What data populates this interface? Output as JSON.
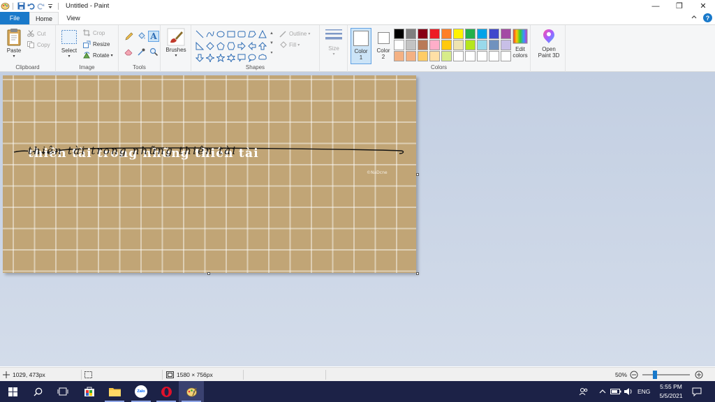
{
  "window": {
    "title": "Untitled - Paint",
    "controls": {
      "minimize": "—",
      "restore": "❐",
      "close": "✕"
    }
  },
  "tabs": [
    {
      "label": "File"
    },
    {
      "label": "Home"
    },
    {
      "label": "View"
    }
  ],
  "ribbon": {
    "clipboard": {
      "group_label": "Clipboard",
      "paste": "Paste",
      "cut": "Cut",
      "copy": "Copy"
    },
    "image": {
      "group_label": "Image",
      "select": "Select",
      "crop": "Crop",
      "resize": "Resize",
      "rotate": "Rotate"
    },
    "tools": {
      "group_label": "Tools",
      "brushes": "Brushes"
    },
    "shapes": {
      "group_label": "Shapes",
      "outline": "Outline",
      "fill": "Fill"
    },
    "size": {
      "label": "Size"
    },
    "colors": {
      "group_label": "Colors",
      "color1": "Color",
      "color1_num": "1",
      "color2": "Color",
      "color2_num": "2",
      "edit_colors_line1": "Edit",
      "edit_colors_line2": "colors",
      "palette_row1": [
        "#000000",
        "#7f7f7f",
        "#880015",
        "#ed1c24",
        "#ff7f27",
        "#fff200",
        "#22b14c",
        "#00a2e8",
        "#3f48cc",
        "#a349a4"
      ],
      "palette_row2": [
        "#ffffff",
        "#c3c3c3",
        "#b97a57",
        "#ffaec9",
        "#ffc90e",
        "#efe4b0",
        "#b5e61d",
        "#99d9ea",
        "#7092be",
        "#c8bfe7"
      ],
      "palette_row3": [
        "#f4b183",
        "#f4b183",
        "#ffcc66",
        "#ffe0a6",
        "#d7ec8a",
        "#ffffff",
        "#ffffff",
        "#ffffff",
        "#ffffff",
        "#ffffff"
      ]
    },
    "paint3d": {
      "line1": "Open",
      "line2": "Paint 3D"
    }
  },
  "canvas": {
    "artwork_text": "thiên tài trong những thiên tài",
    "signature": "©NaDcne",
    "background_color": "#c1a576"
  },
  "status": {
    "cursor_pos": "1029, 473px",
    "image_size": "1580 × 756px",
    "zoom": "50%",
    "zoom_fraction": 0.5
  },
  "taskbar": {
    "language": "ENG",
    "time": "5:55 PM",
    "date": "5/5/2021",
    "zalo_label": "Zalo"
  }
}
